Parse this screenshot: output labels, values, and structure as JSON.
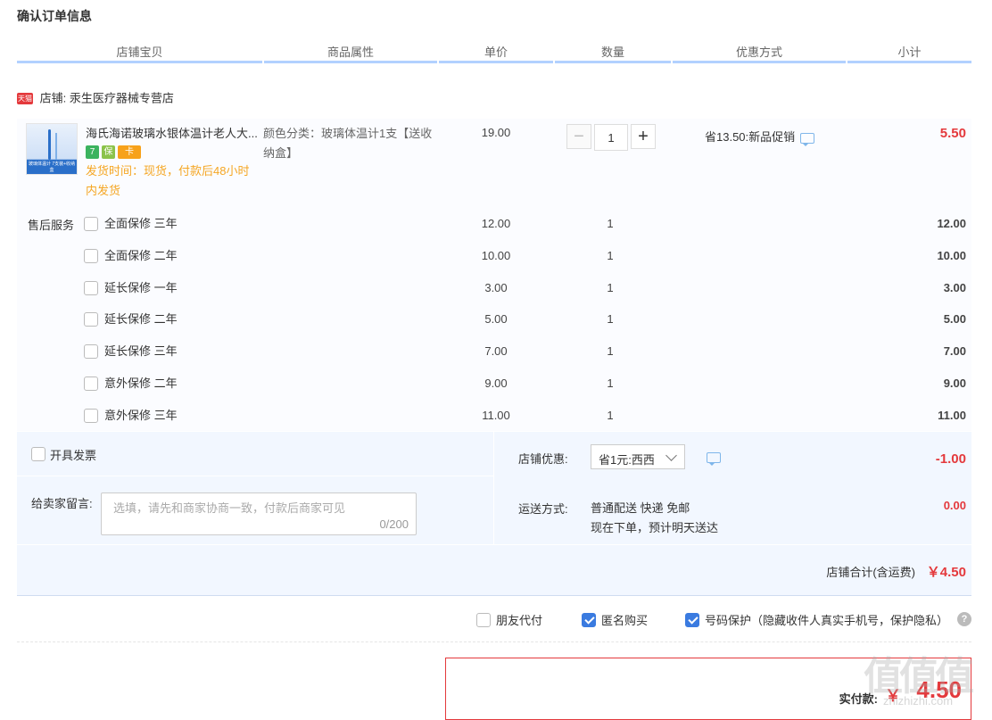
{
  "page": {
    "title": "确认订单信息"
  },
  "table_headers": [
    "店铺宝贝",
    "商品属性",
    "单价",
    "数量",
    "优惠方式",
    "小计"
  ],
  "shop": {
    "badge": "天猫",
    "label": "店铺: 汞生医疗器械专营店"
  },
  "item": {
    "thumb_text": "玻璃体温计 7支装+收纳盒",
    "name": "海氏海诺玻璃水银体温计老人大...",
    "badges": [
      "7",
      "保",
      "卡"
    ],
    "shipping_time": "发货时间：现货，付款后48小时内发货",
    "attribute": "颜色分类：玻璃体温计1支【送收纳盒】",
    "price": "19.00",
    "quantity": "1",
    "qty_minus": "−",
    "qty_plus": "+",
    "promotion": "省13.50:新品促销",
    "subtotal": "5.50"
  },
  "service": {
    "label": "售后服务",
    "rows": [
      {
        "name": "全面保修 三年",
        "price": "12.00",
        "qty": "1",
        "subtotal": "12.00",
        "checked": false
      },
      {
        "name": "全面保修 二年",
        "price": "10.00",
        "qty": "1",
        "subtotal": "10.00",
        "checked": false
      },
      {
        "name": "延长保修 一年",
        "price": "3.00",
        "qty": "1",
        "subtotal": "3.00",
        "checked": false
      },
      {
        "name": "延长保修 二年",
        "price": "5.00",
        "qty": "1",
        "subtotal": "5.00",
        "checked": false
      },
      {
        "name": "延长保修 三年",
        "price": "7.00",
        "qty": "1",
        "subtotal": "7.00",
        "checked": false
      },
      {
        "name": "意外保修 二年",
        "price": "9.00",
        "qty": "1",
        "subtotal": "9.00",
        "checked": false
      },
      {
        "name": "意外保修 三年",
        "price": "11.00",
        "qty": "1",
        "subtotal": "11.00",
        "checked": false
      }
    ]
  },
  "invoice": {
    "label": "开具发票",
    "checked": false
  },
  "message": {
    "label": "给卖家留言:",
    "placeholder": "选填，请先和商家协商一致，付款后商家可见",
    "count": "0/200"
  },
  "discount": {
    "label": "店铺优惠:",
    "selected": "省1元:西西",
    "value": "-1.00"
  },
  "shipping": {
    "label": "运送方式:",
    "line1": "普通配送 快递 免邮",
    "line2": "现在下单，预计明天送达",
    "value": "0.00"
  },
  "shop_total": {
    "label": "店铺合计(含运费)",
    "value": "￥4.50"
  },
  "options": [
    {
      "label": "朋友代付",
      "checked": false
    },
    {
      "label": "匿名购买",
      "checked": true
    },
    {
      "label": "号码保护（隐藏收件人真实手机号，保护隐私）",
      "checked": true
    }
  ],
  "help_icon": "?",
  "payment": {
    "label": "实付款:",
    "currency": "￥",
    "value": "4.50"
  },
  "watermark": {
    "logo": "值值值",
    "site": "zhizhizhi.com"
  },
  "colors": {
    "accent_red": "#e4393c",
    "header_line": "#b2d1ff",
    "checkbox_blue": "#3a7be0",
    "shipping_orange": "#f5a623"
  }
}
